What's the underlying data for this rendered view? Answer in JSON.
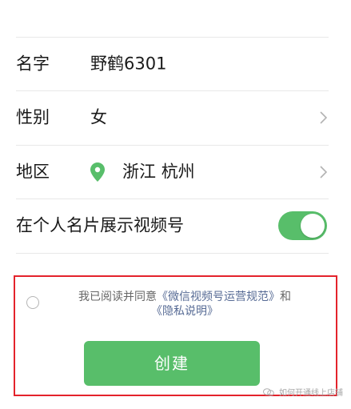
{
  "profile": {
    "name": {
      "label": "名字",
      "value": "野鹤6301"
    },
    "gender": {
      "label": "性别",
      "value": "女"
    },
    "region": {
      "label": "地区",
      "province": "浙江",
      "city": "杭州",
      "icon": "location-pin-icon"
    },
    "show_on_card": {
      "label": "在个人名片展示视频号",
      "enabled": true
    }
  },
  "agreement": {
    "prefix": "我已阅读并同意",
    "link1": "《微信视频号运营规范》",
    "middle": "和",
    "link2": "《隐私说明》",
    "checked": false
  },
  "actions": {
    "create_label": "创建"
  },
  "watermark": {
    "text": "如何开通线上店铺"
  },
  "colors": {
    "accent": "#58be6a",
    "link": "#576b95",
    "highlight_box": "#e4232c"
  }
}
